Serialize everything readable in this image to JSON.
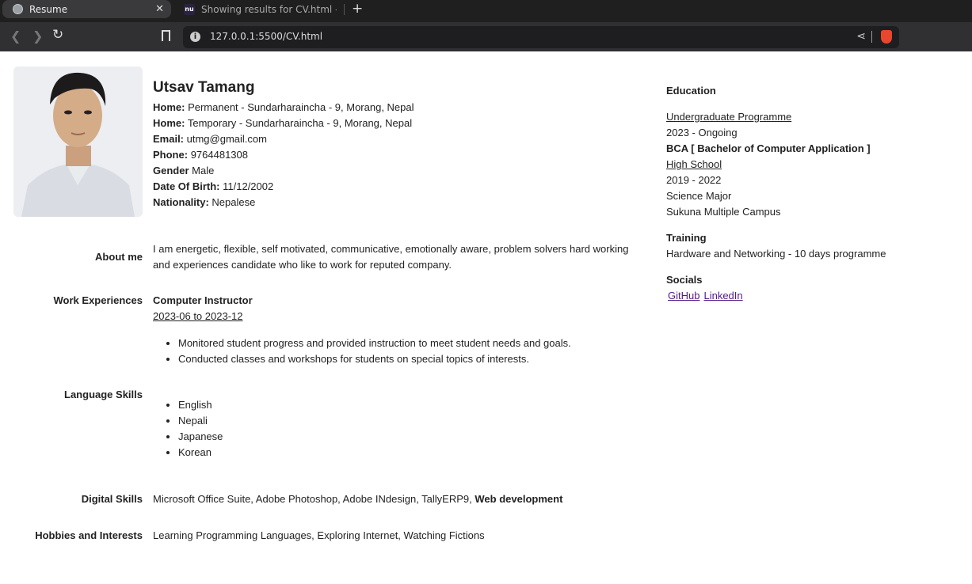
{
  "browser": {
    "active_tab": "Resume",
    "inactive_tab": "Showing results for CV.html –",
    "url": "127.0.0.1:5500/CV.html",
    "favicon_nu": "nu"
  },
  "profile": {
    "name": "Utsav Tamang",
    "rows": [
      {
        "label": "Home:",
        "value": "Permanent - Sundarharaincha - 9, Morang, Nepal"
      },
      {
        "label": "Home:",
        "value": "Temporary - Sundarharaincha - 9, Morang, Nepal"
      },
      {
        "label": "Email:",
        "value": "utmg@gmail.com"
      },
      {
        "label": "Phone:",
        "value": "9764481308"
      },
      {
        "label": "Gender",
        "value": "Male"
      },
      {
        "label": "Date Of Birth:",
        "value": "11/12/2002"
      },
      {
        "label": "Nationality:",
        "value": "Nepalese"
      }
    ]
  },
  "about": {
    "label": "About me",
    "text": "I am energetic, flexible, self motivated, communicative, emotionally aware, problem solvers hard working and experiences candidate who like to work for reputed company."
  },
  "work": {
    "label": "Work Experiences",
    "title": "Computer Instructor",
    "dates": "2023-06 to 2023-12",
    "bullets": [
      "Monitored student progress and provided instruction to meet student needs and goals.",
      "Conducted classes and workshops for students on special topics of interests."
    ]
  },
  "languages": {
    "label": "Language Skills",
    "items": [
      "English",
      "Nepali",
      "Japanese",
      "Korean"
    ]
  },
  "digital": {
    "label": "Digital Skills",
    "text": "Microsoft Office Suite, Adobe Photoshop, Adobe INdesign, TallyERP9,",
    "bold": "Web development"
  },
  "hobbies": {
    "label": "Hobbies and Interests",
    "text": "Learning Programming Languages, Exploring Internet, Watching Fictions"
  },
  "education": {
    "heading": "Education",
    "ug_link": "Undergraduate Programme",
    "ug_years": "2023 - Ongoing",
    "ug_degree": "BCA [ Bachelor of Computer Application ]",
    "hs_link": "High School",
    "hs_years": "2019 - 2022",
    "hs_major": "Science Major",
    "hs_school": "Sukuna Multiple Campus"
  },
  "training": {
    "heading": "Training",
    "text": "Hardware and Networking - 10 days programme"
  },
  "socials": {
    "heading": "Socials",
    "github": "GitHub",
    "linkedin": "LinkedIn"
  },
  "colors": {
    "link_visited": "#551a8b",
    "chrome_dark": "#1f1f20"
  }
}
